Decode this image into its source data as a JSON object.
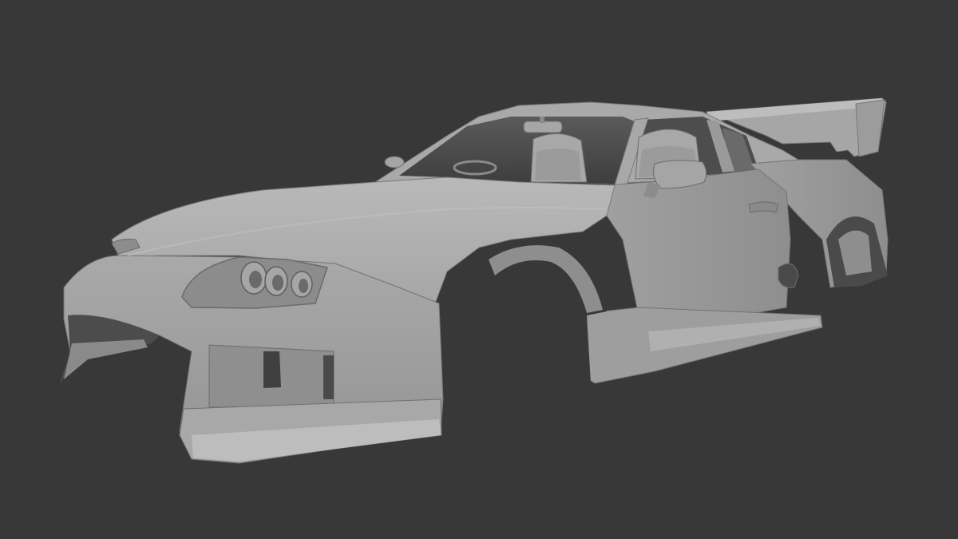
{
  "viewport": {
    "background": "#383838",
    "object_name": "",
    "shading": "solid",
    "object_color": "#9a9a9a"
  },
  "model": {
    "parts": [
      {
        "name": "wing-spoiler"
      },
      {
        "name": "roof-cabin"
      },
      {
        "name": "seat-left"
      },
      {
        "name": "seat-right"
      },
      {
        "name": "rear-view-mirror"
      },
      {
        "name": "side-mirror"
      },
      {
        "name": "hood"
      },
      {
        "name": "front-bumper"
      },
      {
        "name": "headlight-cluster"
      },
      {
        "name": "door"
      },
      {
        "name": "side-skirt"
      },
      {
        "name": "front-wheel-arch"
      },
      {
        "name": "rear-wheel-arch"
      }
    ]
  }
}
